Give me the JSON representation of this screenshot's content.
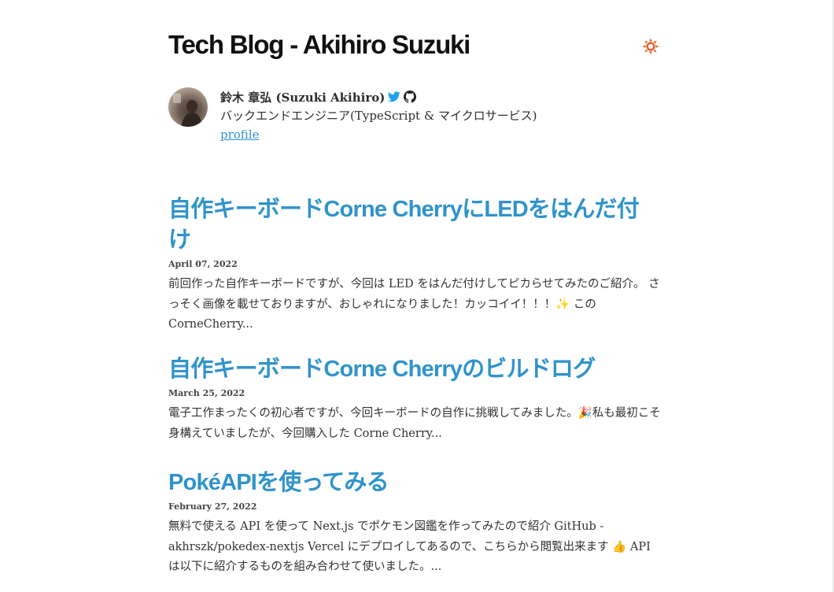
{
  "site": {
    "title": "Tech Blog - Akihiro Suzuki"
  },
  "theme_toggle": {
    "icon": "sun-icon",
    "color": "#e2642b"
  },
  "bio": {
    "name": "鈴木 章弘 (Suzuki Akihiro)",
    "role": "バックエンドエンジニア(TypeScript & マイクロサービス)",
    "profile_link": "profile",
    "twitter_color": "#1da1f2",
    "github_color": "#222222"
  },
  "colors": {
    "accent": "#2f93cc",
    "text": "#2e2e2e"
  },
  "posts": [
    {
      "title": "自作キーボードCorne CherryにLEDをはんだ付け",
      "date": "April 07, 2022",
      "excerpt": "前回作った自作キーボードですが、今回は LED をはんだ付けしてピカらせてみたのご紹介。 さっそく画像を載せておりますが、おしゃれになりました！カッコイイ！！！✨ この CorneCherry..."
    },
    {
      "title": "自作キーボードCorne Cherryのビルドログ",
      "date": "March 25, 2022",
      "excerpt": "電子工作まったくの初心者ですが、今回キーボードの自作に挑戦してみました。🎉私も最初こそ身構えていましたが、今回購入した Corne Cherry..."
    },
    {
      "title": "PokéAPIを使ってみる",
      "date": "February 27, 2022",
      "excerpt": "無料で使える API を使って Next.js でポケモン図鑑を作ってみたので紹介 GitHub - akhrszk/pokedex-nextjs Vercel にデプロイしてあるので、こちらから閲覧出来ます 👍 API は以下に紹介するものを組み合わせて使いました。..."
    }
  ]
}
